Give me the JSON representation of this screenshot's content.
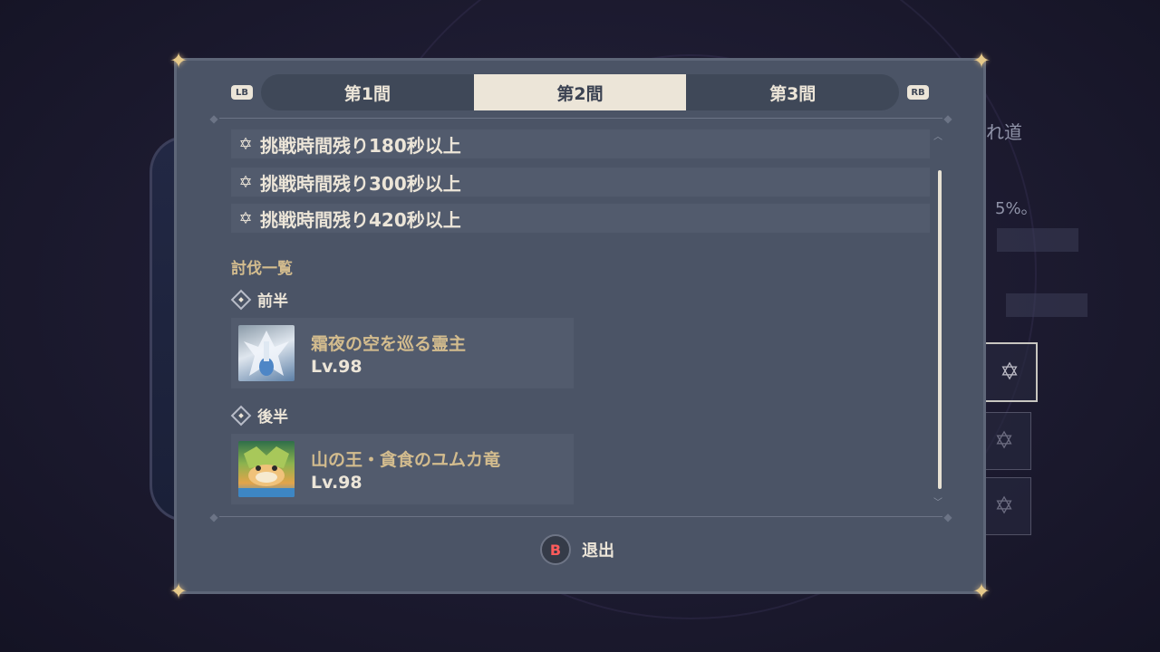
{
  "background": {
    "right_title_fragment": "れ道",
    "right_percent_fragment": "5%。"
  },
  "tabs": {
    "left_shoulder": "LB",
    "right_shoulder": "RB",
    "items": [
      {
        "label": "第1間",
        "active": false
      },
      {
        "label": "第2間",
        "active": true
      },
      {
        "label": "第3間",
        "active": false
      }
    ]
  },
  "conditions": [
    {
      "icon": "star-icon",
      "text": "挑戦時間残り180秒以上"
    },
    {
      "icon": "star-icon",
      "text": "挑戦時間残り300秒以上"
    },
    {
      "icon": "star-icon",
      "text": "挑戦時間残り420秒以上"
    }
  ],
  "enemy_list": {
    "title": "討伐一覧",
    "halves": [
      {
        "label": "前半",
        "enemy": {
          "name": "霜夜の空を巡る霊主",
          "level": "Lv.98",
          "icon": "ice-boss-portrait"
        }
      },
      {
        "label": "後半",
        "enemy": {
          "name": "山の王・貪食のユムカ竜",
          "level": "Lv.98",
          "icon": "dragon-boss-portrait"
        }
      }
    ]
  },
  "footer": {
    "button_glyph": "B",
    "exit_label": "退出"
  },
  "colors": {
    "panel_bg": "#4b5466",
    "row_bg": "#525b6d",
    "accent_gold": "#d3bc8e",
    "text_light": "#ece5d8",
    "b_button_red": "#ff5b5b"
  }
}
